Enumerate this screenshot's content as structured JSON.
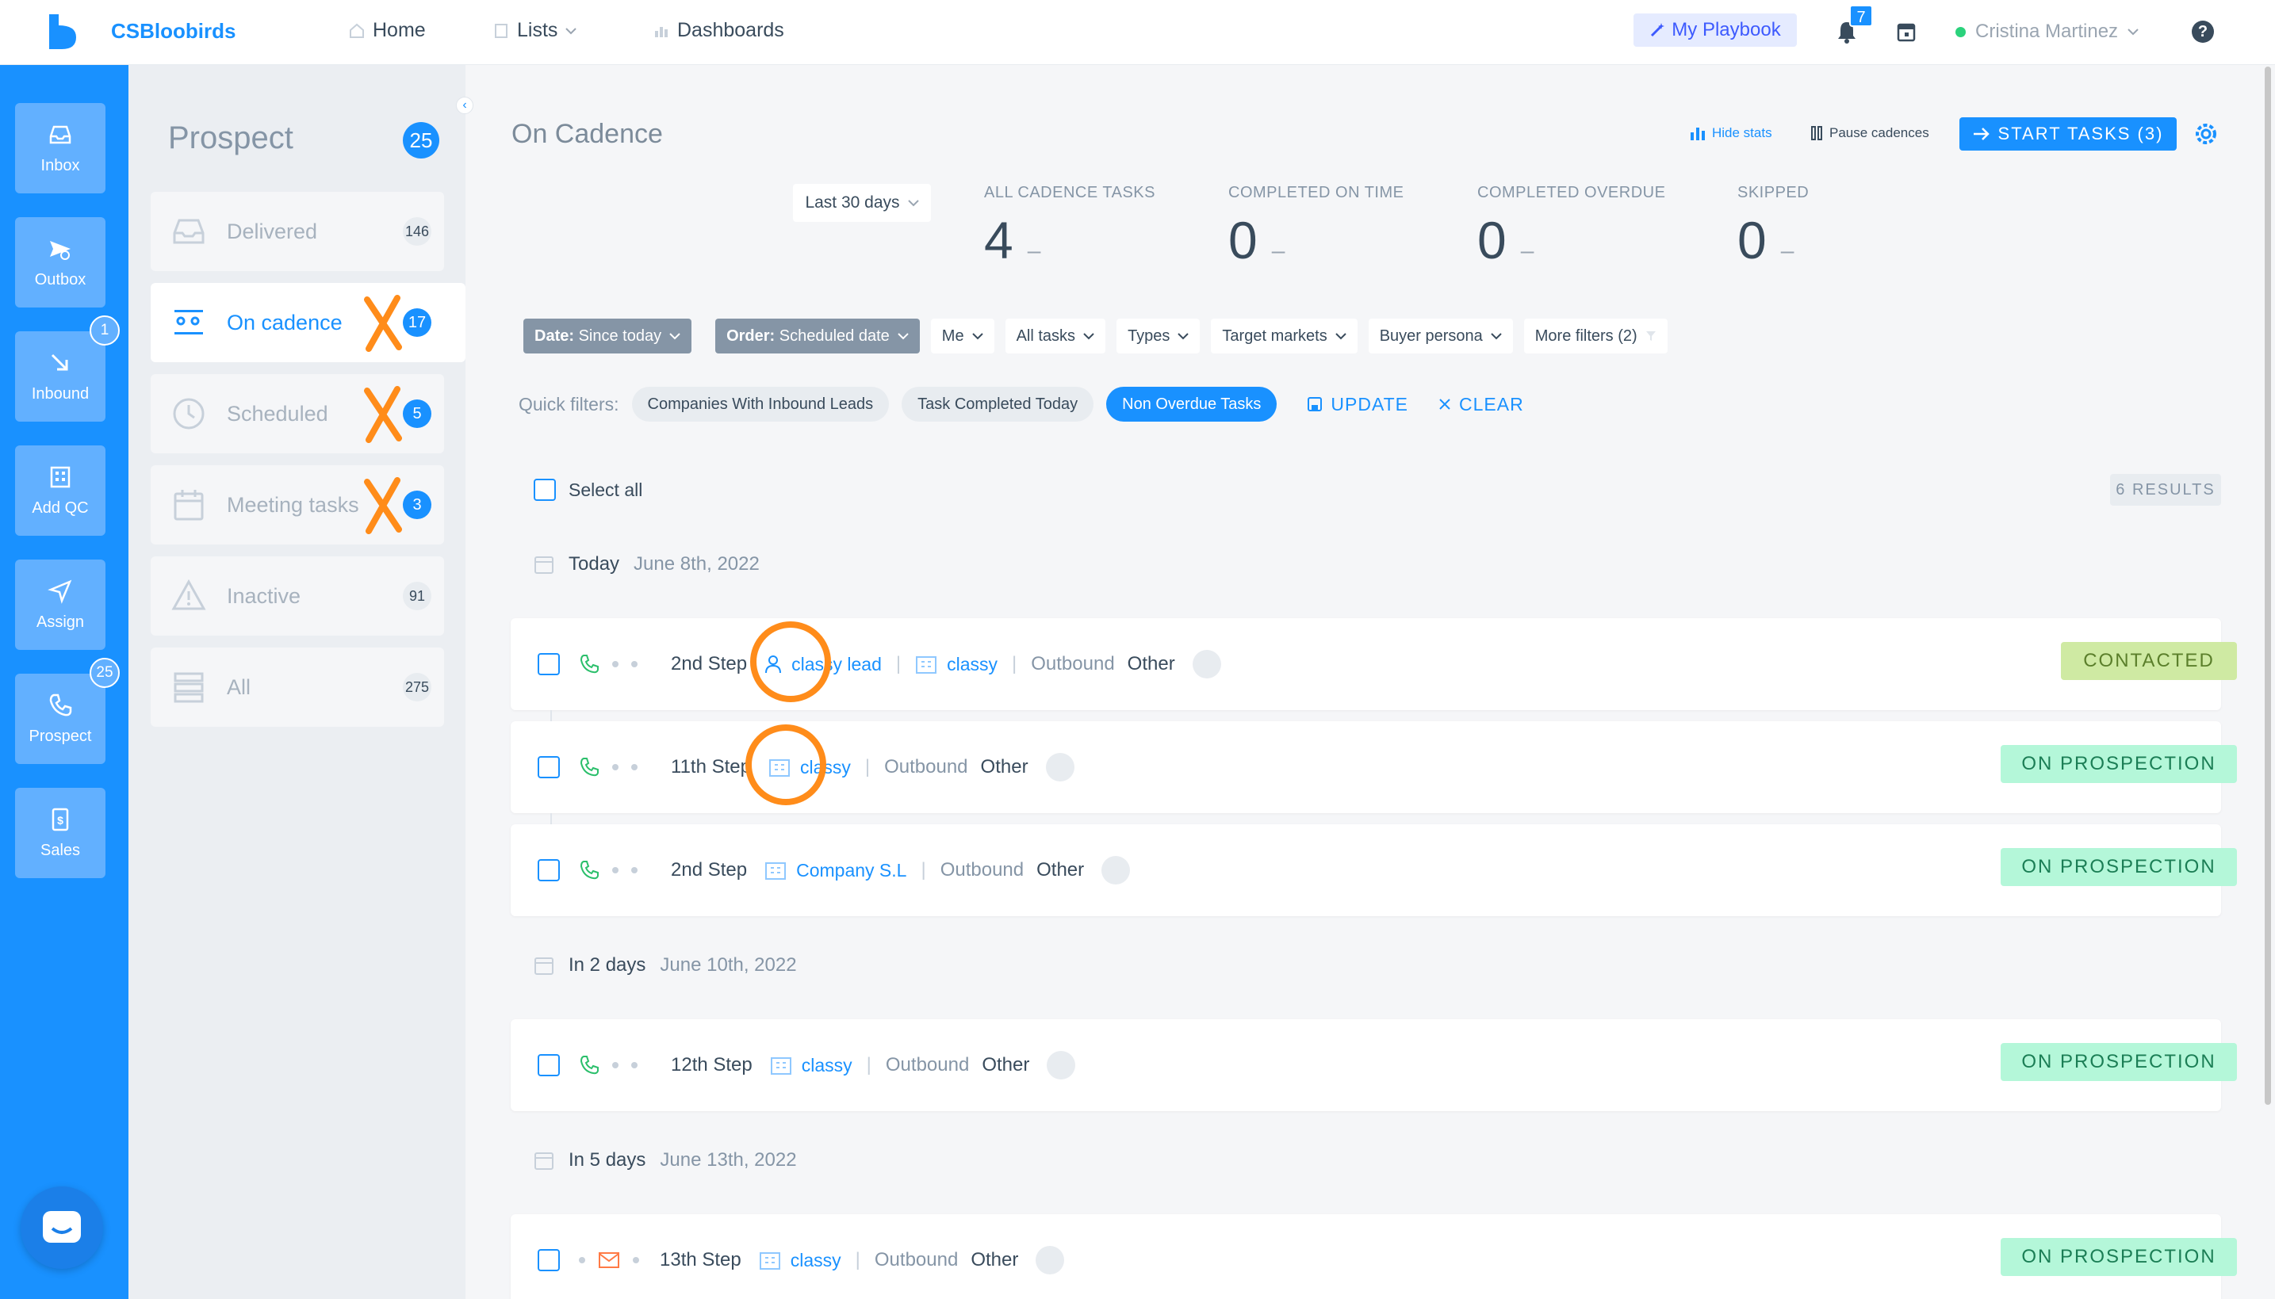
{
  "app": {
    "brand": "CSBloobirds"
  },
  "topnav": {
    "home": "Home",
    "lists": "Lists",
    "dashboards": "Dashboards",
    "playbook": "My Playbook",
    "notifications_count": "7",
    "user_name": "Cristina Martinez"
  },
  "rail": {
    "inbox": "Inbox",
    "outbox": "Outbox",
    "inbound": "Inbound",
    "inbound_badge": "1",
    "add_qc": "Add QC",
    "assign": "Assign",
    "prospect": "Prospect",
    "prospect_badge": "25",
    "sales": "Sales"
  },
  "panel": {
    "title": "Prospect",
    "count": "25",
    "folders": [
      {
        "label": "Delivered",
        "count": "146"
      },
      {
        "label": "On cadence",
        "count": "17"
      },
      {
        "label": "Scheduled",
        "count": "5"
      },
      {
        "label": "Meeting tasks",
        "count": "3"
      },
      {
        "label": "Inactive",
        "count": "91"
      },
      {
        "label": "All",
        "count": "275"
      }
    ]
  },
  "main": {
    "title": "On Cadence",
    "hide_stats": "Hide stats",
    "pause": "Pause cadences",
    "start": "START TASKS (3)",
    "range": "Last 30 days",
    "stats": [
      {
        "label": "ALL CADENCE TASKS",
        "value": "4",
        "dash": "–"
      },
      {
        "label": "COMPLETED ON TIME",
        "value": "0",
        "dash": "–"
      },
      {
        "label": "COMPLETED OVERDUE",
        "value": "0",
        "dash": "–"
      },
      {
        "label": "SKIPPED",
        "value": "0",
        "dash": "–"
      }
    ],
    "filters": {
      "date_key": "Date:",
      "date_val": "Since today",
      "order_key": "Order:",
      "order_val": "Scheduled date",
      "me": "Me",
      "all_tasks": "All tasks",
      "types": "Types",
      "target_markets": "Target markets",
      "buyer_persona": "Buyer persona",
      "more": "More filters (2)"
    },
    "quick": {
      "label": "Quick filters:",
      "chips": [
        "Companies With Inbound Leads",
        "Task Completed Today",
        "Non Overdue Tasks"
      ],
      "update": "UPDATE",
      "clear": "CLEAR"
    },
    "select_all": "Select all",
    "results": "6 RESULTS",
    "groups": [
      {
        "when": "Today",
        "date": "June 8th, 2022"
      },
      {
        "when": "In 2 days",
        "date": "June 10th, 2022"
      },
      {
        "when": "In 5 days",
        "date": "June 13th, 2022"
      }
    ],
    "tasks": [
      {
        "step": "2nd Step",
        "lead": "classy lead",
        "company": "classy",
        "direction": "Outbound",
        "type": "Other",
        "status": "CONTACTED"
      },
      {
        "step": "11th Step",
        "company": "classy",
        "direction": "Outbound",
        "type": "Other",
        "status": "ON PROSPECTION"
      },
      {
        "step": "2nd Step",
        "company": "Company S.L",
        "direction": "Outbound",
        "type": "Other",
        "status": "ON PROSPECTION"
      },
      {
        "step": "12th Step",
        "company": "classy",
        "direction": "Outbound",
        "type": "Other",
        "status": "ON PROSPECTION"
      },
      {
        "step": "13th Step",
        "company": "classy",
        "direction": "Outbound",
        "type": "Other",
        "status": "ON PROSPECTION"
      }
    ]
  },
  "colors": {
    "accent": "#1991ff",
    "annotation": "#ff8c1a",
    "contacted": "#cfeaa3",
    "prospection": "#b4f7d9"
  }
}
